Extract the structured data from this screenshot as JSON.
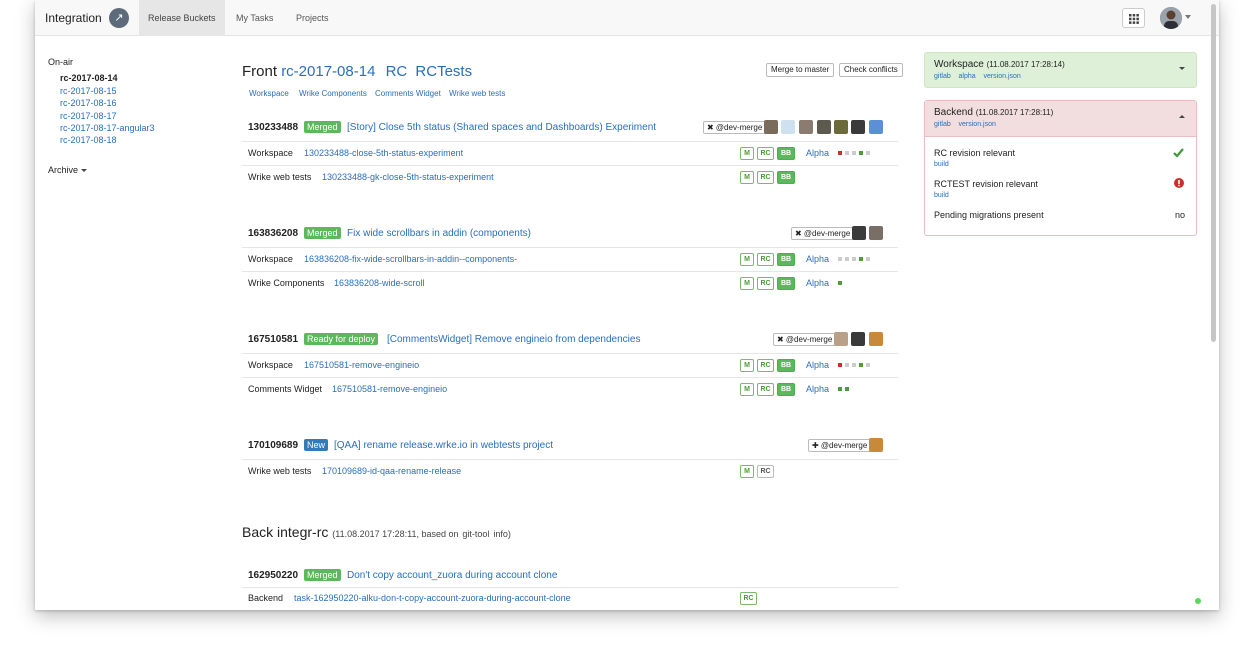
{
  "nav": {
    "brand": "Integration",
    "tabs": [
      "Release Buckets",
      "My Tasks",
      "Projects"
    ]
  },
  "sidebar": {
    "onair_label": "On-air",
    "items": [
      "rc-2017-08-14",
      "rc-2017-08-15",
      "rc-2017-08-16",
      "rc-2017-08-17",
      "rc-2017-08-17-angular3",
      "rc-2017-08-18"
    ],
    "archive_label": "Archive"
  },
  "front": {
    "title_prefix": "Front",
    "title_link": "rc-2017-08-14",
    "rc_link": "RC",
    "rctests_link": "RCTests",
    "subnav": [
      "Workspace",
      "Wrike Components",
      "Comments Widget",
      "Wrike web tests"
    ],
    "merge_btn": "Merge to master",
    "conflicts_btn": "Check conflicts"
  },
  "tasks": [
    {
      "id": "130233488",
      "status": "Merged",
      "title": "[Story] Close 5th status (Shared spaces and Dashboards) Experiment",
      "dev_btn": "✖ @dev-merge",
      "rows": [
        {
          "label": "Workspace",
          "branch": "130233488-close-5th-status-experiment",
          "chips": [
            "M",
            "RC",
            "BB"
          ],
          "alpha": "Alpha"
        },
        {
          "label": "Wrike web tests",
          "branch": "130233488-gk-close-5th-status-experiment",
          "chips": [
            "M",
            "RC",
            "BB"
          ],
          "alpha": ""
        }
      ]
    },
    {
      "id": "163836208",
      "status": "Merged",
      "title": "Fix wide scrollbars in addin (components)",
      "dev_btn": "✖ @dev-merge",
      "rows": [
        {
          "label": "Workspace",
          "branch": "163836208-fix-wide-scrollbars-in-addin--components-",
          "chips": [
            "M",
            "RC",
            "BB"
          ],
          "alpha": "Alpha"
        },
        {
          "label": "Wrike Components",
          "branch": "163836208-wide-scroll",
          "chips": [
            "M",
            "RC",
            "BB"
          ],
          "alpha": "Alpha"
        }
      ]
    },
    {
      "id": "167510581",
      "status": "Ready for deploy",
      "title": "[CommentsWidget] Remove engineio from dependencies",
      "dev_btn": "✖ @dev-merge",
      "rows": [
        {
          "label": "Workspace",
          "branch": "167510581-remove-engineio",
          "chips": [
            "M",
            "RC",
            "BB"
          ],
          "alpha": "Alpha"
        },
        {
          "label": "Comments Widget",
          "branch": "167510581-remove-engineio",
          "chips": [
            "M",
            "RC",
            "BB"
          ],
          "alpha": "Alpha"
        }
      ]
    },
    {
      "id": "170109689",
      "status": "New",
      "title": "[QAA] rename release.wrke.io in webtests project",
      "dev_btn": "✚ @dev-merge",
      "rows": [
        {
          "label": "Wrike web tests",
          "branch": "170109689-id-qaa-rename-release",
          "chips": [
            "M",
            "RC"
          ],
          "alpha": ""
        }
      ]
    }
  ],
  "back": {
    "title": "Back integr-rc",
    "meta_prefix": "(11.08.2017 17:28:11, based on",
    "meta_link": "git-tool",
    "meta_suffix": "info)",
    "task": {
      "id": "162950220",
      "status": "Merged",
      "title": "Don't copy account_zuora during account clone",
      "row_label": "Backend",
      "row_branch": "task-162950220-alku-don-t-copy-account-zuora-during-account-clone",
      "chip": "RC"
    }
  },
  "panels": {
    "workspace": {
      "title": "Workspace",
      "time": "(11.08.2017 17:28:14)",
      "links": [
        "gitlab",
        "alpha",
        "version.json"
      ]
    },
    "backend": {
      "title": "Backend",
      "time": "(11.08.2017 17:28:11)",
      "links": [
        "gitlab",
        "version.json"
      ],
      "items": [
        {
          "label": "RC revision relevant",
          "sub": "build",
          "value": ""
        },
        {
          "label": "RCTEST revision relevant",
          "sub": "build",
          "value": ""
        },
        {
          "label": "Pending migrations present",
          "sub": "",
          "value": "no"
        }
      ]
    }
  },
  "colors": {
    "link": "#2a6ebb",
    "merged": "#5cb85c",
    "ready": "#5cb85c",
    "new": "#337ab7",
    "ok_panel": "#dff0d8",
    "err_panel": "#f2dede",
    "check": "#3c9a3c",
    "error": "#c9302c"
  },
  "icons": {
    "rocket": "rocket-icon",
    "apps": "grid-icon",
    "check": "check-icon",
    "error": "exclamation-circle-icon"
  }
}
